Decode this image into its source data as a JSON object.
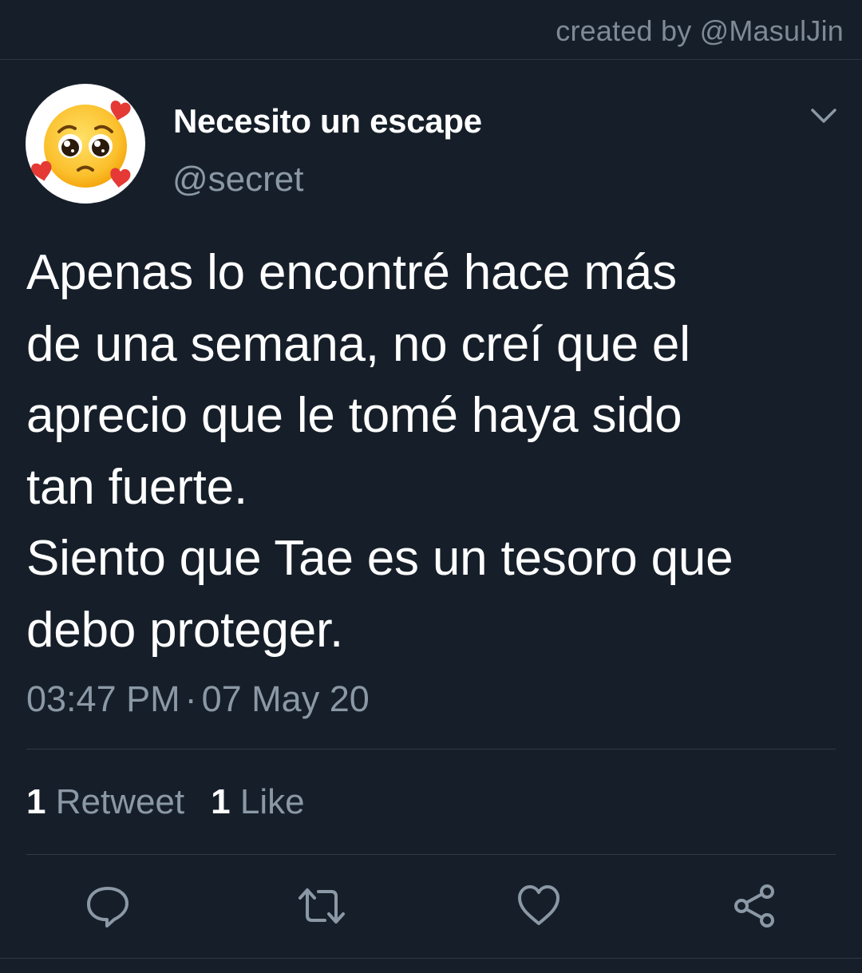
{
  "header": {
    "credit": "created by @MasulJin"
  },
  "tweet": {
    "avatar_icon": "pleading-face-with-hearts-emoji",
    "display_name": "Necesito un escape",
    "handle": "@secret",
    "text": "Apenas lo encontré hace más\nde una semana, no creí que el\naprecio que le tomé haya sido\ntan fuerte.\nSiento que Tae es un tesoro que\ndebo proteger.",
    "time": "03:47 PM",
    "separator": "·",
    "date": "07 May 20"
  },
  "stats": {
    "retweet_count": "1",
    "retweet_label": "Retweet",
    "like_count": "1",
    "like_label": "Like"
  },
  "actions": {
    "reply_icon": "reply-icon",
    "retweet_icon": "retweet-icon",
    "like_icon": "heart-icon",
    "share_icon": "share-icon"
  },
  "colors": {
    "background": "#161f29",
    "secondary_text": "#8b98a5",
    "divider": "#2f3a45"
  }
}
